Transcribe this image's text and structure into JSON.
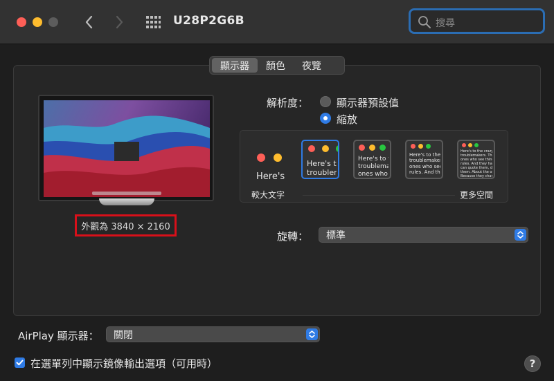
{
  "window": {
    "title": "U28P2G6B",
    "search_placeholder": "搜尋"
  },
  "tabs": [
    {
      "label": "顯示器",
      "active": true
    },
    {
      "label": "顏色",
      "active": false
    },
    {
      "label": "夜覽",
      "active": false
    }
  ],
  "display": {
    "looks_like": "外觀為 3840 × 2160"
  },
  "resolution": {
    "label": "解析度：",
    "options": [
      {
        "label": "顯示器預設值",
        "selected": false
      },
      {
        "label": "縮放",
        "selected": true
      }
    ],
    "scaled": {
      "left_label": "較大文字",
      "right_label": "更多空間",
      "samples": [
        {
          "text": "Here's",
          "selected": false
        },
        {
          "text": "Here's to\ntroublem",
          "selected": true
        },
        {
          "text": "Here's to t\ntroublema\nones who",
          "selected": false
        },
        {
          "text": "Here's to the cr\ntroublemakers.\nones who see th\nrules. And they",
          "selected": false
        },
        {
          "text": "Here's to the crazy one\ntroublemakers. The rou\nones who see things di\nrules. And they have n\ncan quote them, disagre\nthem. About the only\nBecause they change th",
          "selected": false
        }
      ]
    }
  },
  "rotation": {
    "label": "旋轉：",
    "value": "標準"
  },
  "airplay": {
    "label": "AirPlay 顯示器：",
    "value": "關閉"
  },
  "mirroring": {
    "label": "在選單列中顯示鏡像輸出選項（可用時）",
    "checked": true
  },
  "help_label": "?",
  "colors": {
    "accent": "#2f7be5",
    "highlight_box": "#d8101a"
  }
}
